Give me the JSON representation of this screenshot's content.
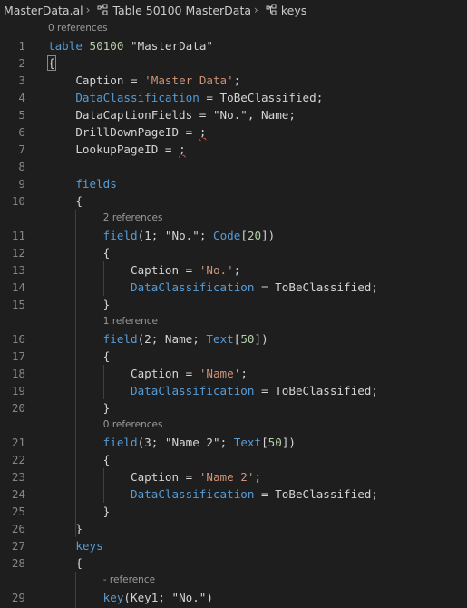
{
  "breadcrumb": {
    "file": "MasterData.al",
    "table": "Table 50100 MasterData",
    "keys": "keys"
  },
  "lines": [
    {
      "type": "lens",
      "text": "0 references",
      "indent": 0
    },
    {
      "type": "code",
      "num": "1",
      "tokens": [
        [
          "kw",
          "table "
        ],
        [
          "num",
          "50100"
        ],
        [
          "txt",
          " \"MasterData\""
        ]
      ]
    },
    {
      "type": "code",
      "num": "2",
      "tokens": [
        [
          "txt",
          "{"
        ]
      ],
      "cursorBrace": true
    },
    {
      "type": "code",
      "num": "3",
      "tokens": [
        [
          "txt",
          "    Caption = "
        ],
        [
          "str",
          "'Master Data'"
        ],
        [
          "txt",
          ";"
        ]
      ]
    },
    {
      "type": "code",
      "num": "4",
      "tokens": [
        [
          "prop",
          "    DataClassification"
        ],
        [
          "txt",
          " = ToBeClassified;"
        ]
      ]
    },
    {
      "type": "code",
      "num": "5",
      "tokens": [
        [
          "txt",
          "    DataCaptionFields = \"No.\", Name;"
        ]
      ]
    },
    {
      "type": "code",
      "num": "6",
      "tokens": [
        [
          "txt",
          "    DrillDownPageID = "
        ],
        [
          "squig",
          ";"
        ]
      ]
    },
    {
      "type": "code",
      "num": "7",
      "tokens": [
        [
          "txt",
          "    LookupPageID = "
        ],
        [
          "squig",
          ";"
        ]
      ]
    },
    {
      "type": "code",
      "num": "8",
      "tokens": []
    },
    {
      "type": "code",
      "num": "9",
      "tokens": [
        [
          "kw",
          "    fields"
        ]
      ]
    },
    {
      "type": "code",
      "num": "10",
      "tokens": [
        [
          "txt",
          "    {"
        ]
      ]
    },
    {
      "type": "lens",
      "text": "2 references",
      "indent": 8
    },
    {
      "type": "code",
      "num": "11",
      "tokens": [
        [
          "kw",
          "        field"
        ],
        [
          "txt",
          "(1; \"No.\"; "
        ],
        [
          "kw",
          "Code"
        ],
        [
          "txt",
          "["
        ],
        [
          "num",
          "20"
        ],
        [
          "txt",
          "])"
        ]
      ]
    },
    {
      "type": "code",
      "num": "12",
      "tokens": [
        [
          "txt",
          "        {"
        ]
      ]
    },
    {
      "type": "code",
      "num": "13",
      "tokens": [
        [
          "txt",
          "            Caption = "
        ],
        [
          "str",
          "'No.'"
        ],
        [
          "txt",
          ";"
        ]
      ]
    },
    {
      "type": "code",
      "num": "14",
      "tokens": [
        [
          "prop",
          "            DataClassification"
        ],
        [
          "txt",
          " = ToBeClassified;"
        ]
      ]
    },
    {
      "type": "code",
      "num": "15",
      "tokens": [
        [
          "txt",
          "        }"
        ]
      ]
    },
    {
      "type": "lens",
      "text": "1 reference",
      "indent": 8
    },
    {
      "type": "code",
      "num": "16",
      "tokens": [
        [
          "kw",
          "        field"
        ],
        [
          "txt",
          "(2; Name; "
        ],
        [
          "kw",
          "Text"
        ],
        [
          "txt",
          "["
        ],
        [
          "num",
          "50"
        ],
        [
          "txt",
          "])"
        ]
      ]
    },
    {
      "type": "code",
      "num": "17",
      "tokens": [
        [
          "txt",
          "        {"
        ]
      ]
    },
    {
      "type": "code",
      "num": "18",
      "tokens": [
        [
          "txt",
          "            Caption = "
        ],
        [
          "str",
          "'Name'"
        ],
        [
          "txt",
          ";"
        ]
      ]
    },
    {
      "type": "code",
      "num": "19",
      "tokens": [
        [
          "prop",
          "            DataClassification"
        ],
        [
          "txt",
          " = ToBeClassified;"
        ]
      ]
    },
    {
      "type": "code",
      "num": "20",
      "tokens": [
        [
          "txt",
          "        }"
        ]
      ]
    },
    {
      "type": "lens",
      "text": "0 references",
      "indent": 8
    },
    {
      "type": "code",
      "num": "21",
      "tokens": [
        [
          "kw",
          "        field"
        ],
        [
          "txt",
          "(3; \"Name 2\"; "
        ],
        [
          "kw",
          "Text"
        ],
        [
          "txt",
          "["
        ],
        [
          "num",
          "50"
        ],
        [
          "txt",
          "])"
        ]
      ]
    },
    {
      "type": "code",
      "num": "22",
      "tokens": [
        [
          "txt",
          "        {"
        ]
      ]
    },
    {
      "type": "code",
      "num": "23",
      "tokens": [
        [
          "txt",
          "            Caption = "
        ],
        [
          "str",
          "'Name 2'"
        ],
        [
          "txt",
          ";"
        ]
      ]
    },
    {
      "type": "code",
      "num": "24",
      "tokens": [
        [
          "prop",
          "            DataClassification"
        ],
        [
          "txt",
          " = ToBeClassified;"
        ]
      ]
    },
    {
      "type": "code",
      "num": "25",
      "tokens": [
        [
          "txt",
          "        }"
        ]
      ]
    },
    {
      "type": "code",
      "num": "26",
      "tokens": [
        [
          "txt",
          "    }"
        ]
      ]
    },
    {
      "type": "code",
      "num": "27",
      "tokens": [
        [
          "kw",
          "    keys"
        ]
      ]
    },
    {
      "type": "code",
      "num": "28",
      "tokens": [
        [
          "txt",
          "    {"
        ]
      ]
    },
    {
      "type": "lens",
      "text": "- reference",
      "indent": 8
    },
    {
      "type": "code",
      "num": "29",
      "tokens": [
        [
          "kw",
          "        key"
        ],
        [
          "txt",
          "(Key1; \"No.\")"
        ]
      ]
    }
  ],
  "colors": {
    "background": "#1e1e1e",
    "keyword": "#569cd6",
    "string": "#ce9178",
    "number": "#b5cea8",
    "text": "#d4d4d4",
    "line_number": "#858585",
    "codelens": "#999999"
  },
  "icons": [
    "chevron-right-icon",
    "symbol-structure-icon"
  ]
}
